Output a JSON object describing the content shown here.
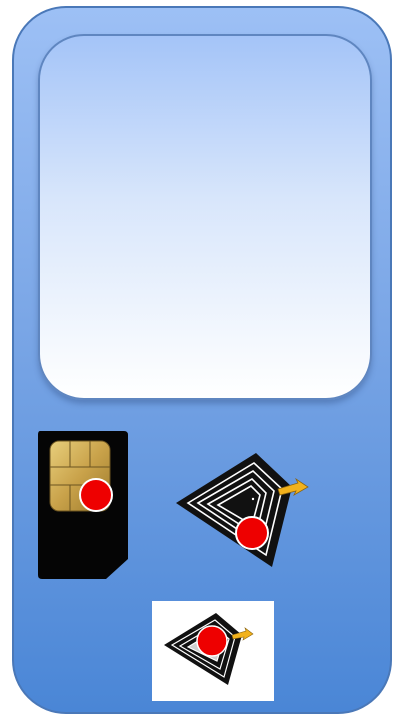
{
  "device": {
    "name": "phone",
    "icons": [
      "sim-card-icon",
      "nfc-tag-icon",
      "nfc-tag-icon"
    ]
  },
  "colors": {
    "phone_top": "#9dc0f5",
    "phone_bottom": "#4a86d6",
    "screen_top": "#a4c4f8",
    "screen_bottom": "#ffffff",
    "marker": "#ee0000",
    "chip_gold": "#c9a24a",
    "antenna_arrow": "#f2b21c"
  }
}
